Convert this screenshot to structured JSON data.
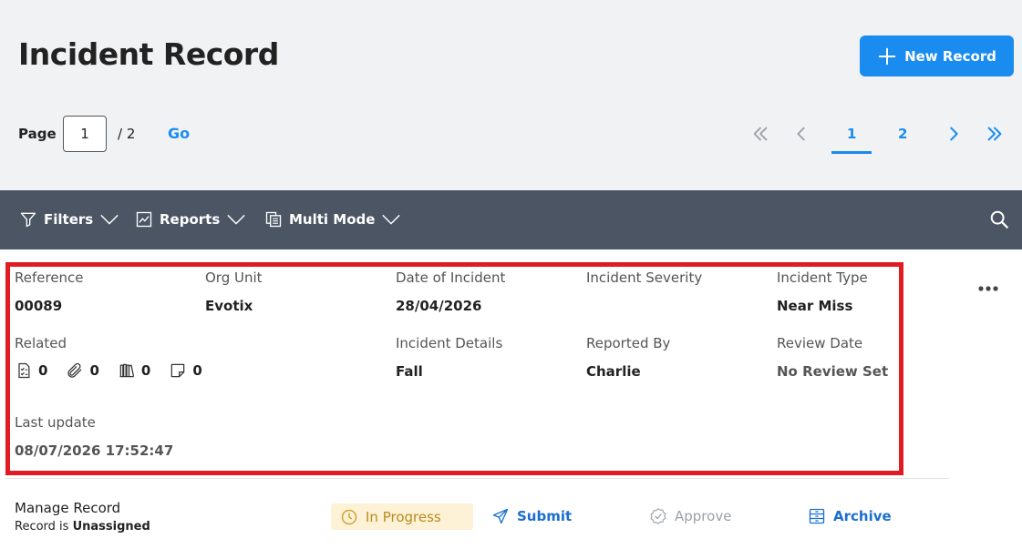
{
  "header": {
    "title": "Incident Record",
    "new_record_label": "New Record"
  },
  "pagination": {
    "page_label": "Page",
    "current_page": "1",
    "total_label": "/ 2",
    "go_label": "Go",
    "pages": [
      "1",
      "2"
    ]
  },
  "toolbar": {
    "filters_label": "Filters",
    "reports_label": "Reports",
    "multi_mode_label": "Multi Mode"
  },
  "record": {
    "reference": {
      "label": "Reference",
      "value": "00089"
    },
    "org_unit": {
      "label": "Org Unit",
      "value": "Evotix"
    },
    "date_of_incident": {
      "label": "Date of Incident",
      "value": "28/04/2026"
    },
    "incident_severity": {
      "label": "Incident Severity",
      "value": ""
    },
    "incident_type": {
      "label": "Incident Type",
      "value": "Near Miss"
    },
    "related": {
      "label": "Related",
      "checklists": "0",
      "attachments": "0",
      "library": "0",
      "notes": "0"
    },
    "incident_details": {
      "label": "Incident Details",
      "value": "Fall"
    },
    "reported_by": {
      "label": "Reported By",
      "value": "Charlie"
    },
    "review_date": {
      "label": "Review Date",
      "value": "No Review Set"
    },
    "last_update": {
      "label": "Last update",
      "value": "08/07/2026 17:52:47"
    }
  },
  "manage": {
    "title": "Manage Record",
    "sub_prefix": "Record is",
    "assignment": "Unassigned",
    "status": "In Progress",
    "submit_label": "Submit",
    "approve_label": "Approve",
    "archive_label": "Archive"
  },
  "colors": {
    "accent": "#1a8cf0",
    "toolbar_bg": "#4c5564",
    "highlight_border": "#e01b24",
    "status_bg": "#fdf1d6"
  }
}
